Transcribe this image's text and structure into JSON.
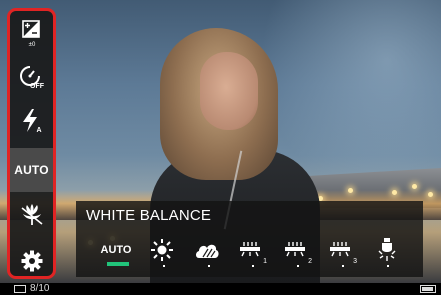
{
  "toolbar": {
    "items": [
      {
        "name": "exposure-compensation",
        "icon": "exposure-plus-minus-icon",
        "sublabel": "±0"
      },
      {
        "name": "self-timer",
        "icon": "self-timer-off-icon",
        "sublabel": "OFF"
      },
      {
        "name": "flash",
        "icon": "flash-auto-icon",
        "sublabel": "A"
      },
      {
        "name": "white-balance",
        "label": "AUTO",
        "selected": true
      },
      {
        "name": "macro",
        "icon": "macro-flower-icon"
      },
      {
        "name": "settings",
        "icon": "gear-icon"
      }
    ],
    "highlight_color": "#e02424"
  },
  "white_balance": {
    "title": "WHITE BALANCE",
    "selected": "AUTO",
    "accent": "#21c37a",
    "options": [
      {
        "name": "auto",
        "label": "AUTO"
      },
      {
        "name": "daylight",
        "icon": "sun-icon"
      },
      {
        "name": "cloudy",
        "icon": "cloud-icon"
      },
      {
        "name": "fluorescent-1",
        "icon": "fluorescent-icon",
        "sub": "1"
      },
      {
        "name": "fluorescent-2",
        "icon": "fluorescent-icon",
        "sub": "2"
      },
      {
        "name": "fluorescent-3",
        "icon": "fluorescent-icon",
        "sub": "3"
      },
      {
        "name": "incandescent",
        "icon": "bulb-icon"
      }
    ]
  },
  "status": {
    "image_count": "8/10",
    "card_icon": "memory-card-icon",
    "battery_icon": "battery-icon"
  }
}
